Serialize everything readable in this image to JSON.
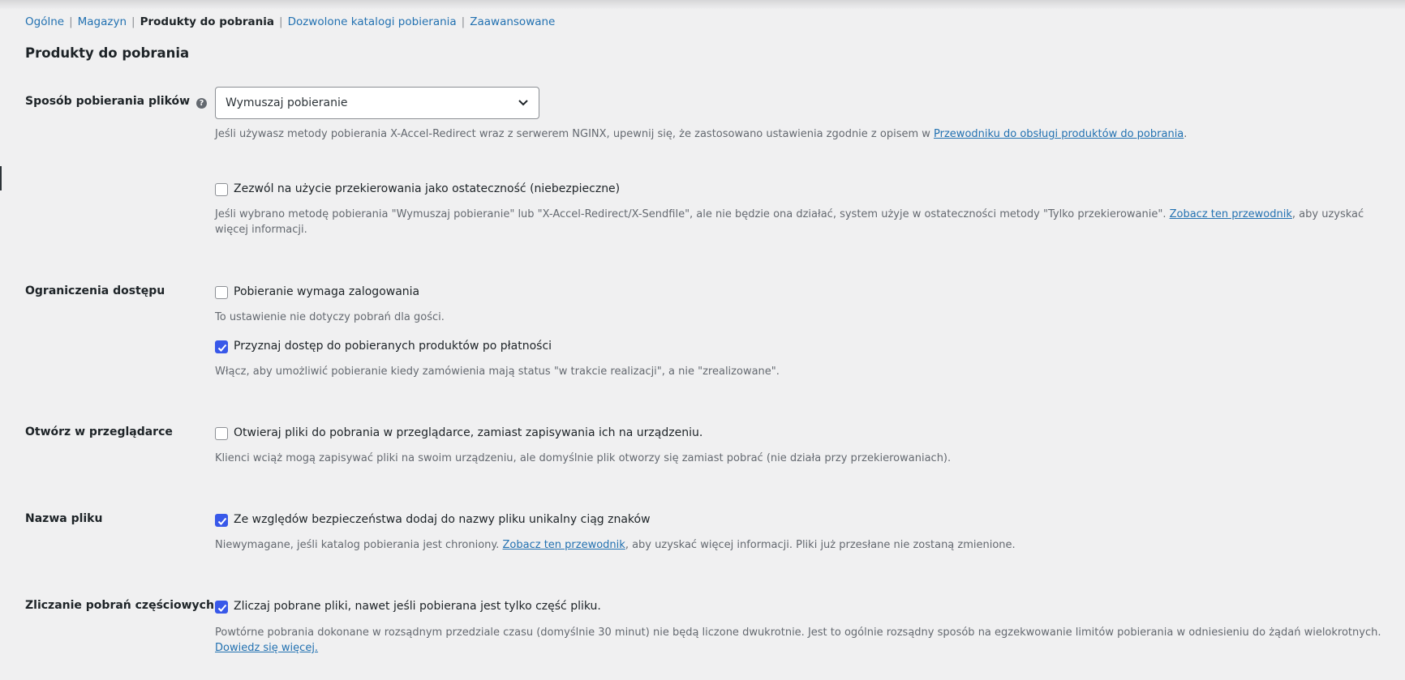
{
  "subnav": {
    "items": [
      "Ogólne",
      "Magazyn",
      "Produkty do pobrania",
      "Dozwolone katalogi pobierania",
      "Zaawansowane"
    ],
    "current_index": 2
  },
  "page_title": "Produkty do pobrania",
  "download_method": {
    "label": "Sposób pobierania plików",
    "help_icon": "question-circle-icon",
    "select_value": "Wymuszaj pobieranie",
    "desc_before": "Jeśli używasz metody pobierania X-Accel-Redirect wraz z serwerem NGINX, upewnij się, że zastosowano ustawienia zgodnie z opisem w ",
    "desc_link": "Przewodniku do obsługi produktów do pobrania",
    "desc_after": "."
  },
  "redirect_fallback": {
    "checkbox_label": "Zezwól na użycie przekierowania jako ostateczność (niebezpieczne)",
    "checked": false,
    "desc_before": "Jeśli wybrano metodę pobierania \"Wymuszaj pobieranie\" lub \"X-Accel-Redirect/X-Sendfile\", ale nie będzie ona działać, system użyje w ostateczności metody \"Tylko przekierowanie\". ",
    "desc_link": "Zobacz ten przewodnik",
    "desc_after": ", aby uzyskać więcej informacji."
  },
  "access_restriction": {
    "label": "Ograniczenia dostępu",
    "login_checkbox_label": "Pobieranie wymaga zalogowania",
    "login_checked": false,
    "login_desc": "To ustawienie nie dotyczy pobrań dla gości.",
    "grant_checkbox_label": "Przyznaj dostęp do pobieranych produktów po płatności",
    "grant_checked": true,
    "grant_desc": "Włącz, aby umożliwić pobieranie kiedy zamówienia mają status \"w trakcie realizacji\", a nie \"zrealizowane\"."
  },
  "open_in_browser": {
    "label": "Otwórz w przeglądarce",
    "checkbox_label": "Otwieraj pliki do pobrania w przeglądarce, zamiast zapisywania ich na urządzeniu.",
    "checked": false,
    "desc": "Klienci wciąż mogą zapisywać pliki na swoim urządzeniu, ale domyślnie plik otworzy się zamiast pobrać (nie działa przy przekierowaniach)."
  },
  "filename": {
    "label": "Nazwa pliku",
    "checkbox_label": "Ze względów bezpieczeństwa dodaj do nazwy pliku unikalny ciąg znaków",
    "checked": true,
    "desc_before": "Niewymagane, jeśli katalog pobierania jest chroniony. ",
    "desc_link": "Zobacz ten przewodnik",
    "desc_after": ", aby uzyskać więcej informacji. Pliki już przesłane nie zostaną zmienione."
  },
  "partial_downloads": {
    "label": "Zliczanie pobrań częściowych",
    "checkbox_label": "Zliczaj pobrane pliki, nawet jeśli pobierana jest tylko część pliku.",
    "checked": true,
    "desc_before": "Powtórne pobrania dokonane w rozsądnym przedziale czasu (domyślnie 30 minut) nie będą liczone dwukrotnie. Jest to ogólnie rozsądny sposób na egzekwowanie limitów pobierania w odniesieniu do żądań wielokrotnych. ",
    "desc_link": "Dowiedz się więcej."
  },
  "colors": {
    "link": "#2271b1",
    "checkbox_checked": "#3858e9",
    "background": "#f0f0f1"
  }
}
